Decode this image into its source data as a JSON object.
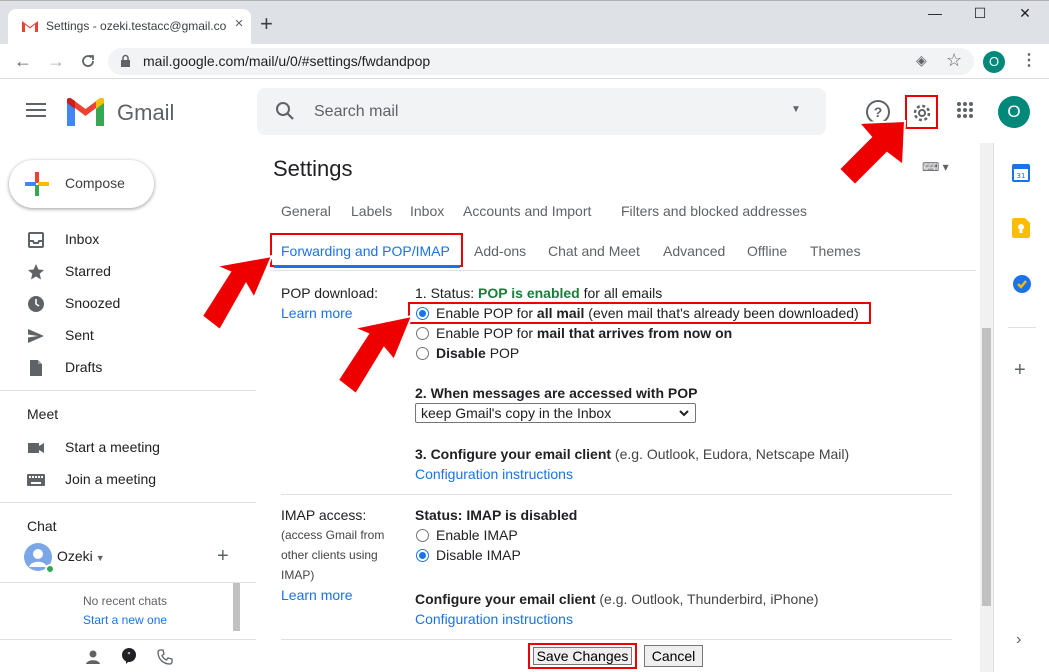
{
  "browser": {
    "tab_title": "Settings - ozeki.testacc@gmail.com",
    "url": "mail.google.com/mail/u/0/#settings/fwdandpop",
    "profile_initial": "O",
    "new_tab": "+",
    "close_tab": "×",
    "minimize": "—",
    "maximize": "☐",
    "close_window": "✕"
  },
  "header": {
    "app_name": "Gmail",
    "search_placeholder": "Search mail",
    "avatar_initial": "O"
  },
  "sidebar": {
    "compose_label": "Compose",
    "items": [
      {
        "label": "Inbox",
        "icon": "inbox-icon"
      },
      {
        "label": "Starred",
        "icon": "star-icon"
      },
      {
        "label": "Snoozed",
        "icon": "clock-icon"
      },
      {
        "label": "Sent",
        "icon": "send-icon"
      },
      {
        "label": "Drafts",
        "icon": "draft-icon"
      }
    ],
    "meet_title": "Meet",
    "meet_items": [
      {
        "label": "Start a meeting",
        "icon": "video-icon"
      },
      {
        "label": "Join a meeting",
        "icon": "keyboard-icon"
      }
    ],
    "chat_title": "Chat",
    "chat_user": "Ozeki",
    "no_chats": "No recent chats",
    "start_chat": "Start a new one"
  },
  "settings": {
    "title": "Settings",
    "tabs_row1": [
      "General",
      "Labels",
      "Inbox",
      "Accounts and Import",
      "Filters and blocked addresses"
    ],
    "tabs_row2": [
      "Forwarding and POP/IMAP",
      "Add-ons",
      "Chat and Meet",
      "Advanced",
      "Offline",
      "Themes"
    ],
    "pop": {
      "label": "POP download:",
      "learn_more": "Learn more",
      "status_prefix": "1. Status: ",
      "status_value": "POP is enabled",
      "status_suffix": " for all emails",
      "opt1_a": "Enable POP for ",
      "opt1_b": "all mail",
      "opt1_c": " (even mail that's already been downloaded)",
      "opt2_a": "Enable POP for ",
      "opt2_b": "mail that arrives from now on",
      "opt3_a": "Disable",
      "opt3_b": " POP",
      "accessed_title": "2. When messages are accessed with POP",
      "accessed_value": "keep Gmail's copy in the Inbox",
      "configure_title": "3. Configure your email client",
      "configure_hint": " (e.g. Outlook, Eudora, Netscape Mail)",
      "config_link": "Configuration instructions"
    },
    "imap": {
      "label": "IMAP access:",
      "hint_lines": [
        "(access Gmail from",
        "other clients using",
        "IMAP)"
      ],
      "learn_more": "Learn more",
      "status": "Status: IMAP is disabled",
      "opt_enable": "Enable IMAP",
      "opt_disable": "Disable IMAP",
      "configure_title": "Configure your email client",
      "configure_hint": " (e.g. Outlook, Thunderbird, iPhone)",
      "config_link": "Configuration instructions"
    },
    "save_label": "Save Changes",
    "cancel_label": "Cancel"
  },
  "colors": {
    "accent": "#1a73e8",
    "highlight_red": "#ee0000",
    "status_green": "#188038"
  }
}
